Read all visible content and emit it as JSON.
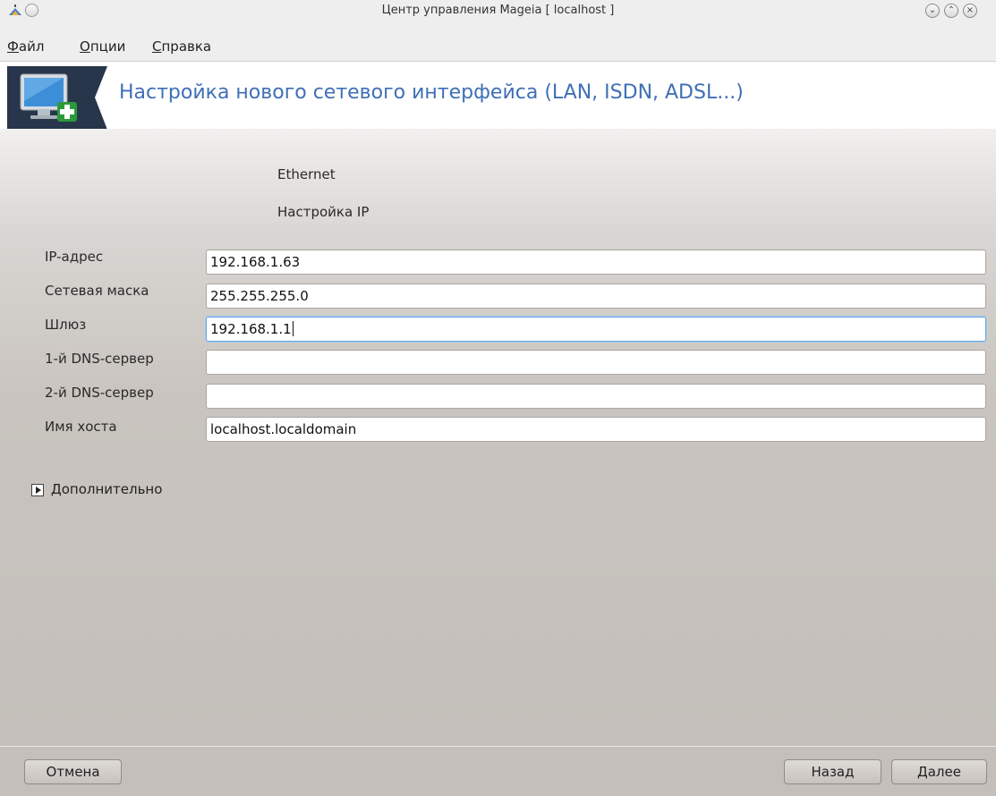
{
  "window": {
    "title": "Центр управления Mageia  [ localhost ]"
  },
  "menu": {
    "file": "Файл",
    "options": "Опции",
    "help": "Справка"
  },
  "header": {
    "title": "Настройка нового сетевого интерфейса (LAN, ISDN, ADSL...)",
    "icon": "network-monitor-add-icon"
  },
  "main": {
    "connection_type": "Ethernet",
    "section_title": "Настройка IP",
    "fields": {
      "ip": {
        "label": "IP-адрес",
        "value": "192.168.1.63"
      },
      "netmask": {
        "label": "Сетевая маска",
        "value": "255.255.255.0"
      },
      "gateway": {
        "label": "Шлюз",
        "value": "192.168.1.1"
      },
      "dns1": {
        "label": "1-й DNS-сервер",
        "value": ""
      },
      "dns2": {
        "label": "2-й DNS-сервер",
        "value": ""
      },
      "hostname": {
        "label": "Имя хоста",
        "value": "localhost.localdomain"
      }
    },
    "advanced": "Дополнительно"
  },
  "buttons": {
    "cancel": "Отмена",
    "back": "Назад",
    "next": "Далее"
  }
}
